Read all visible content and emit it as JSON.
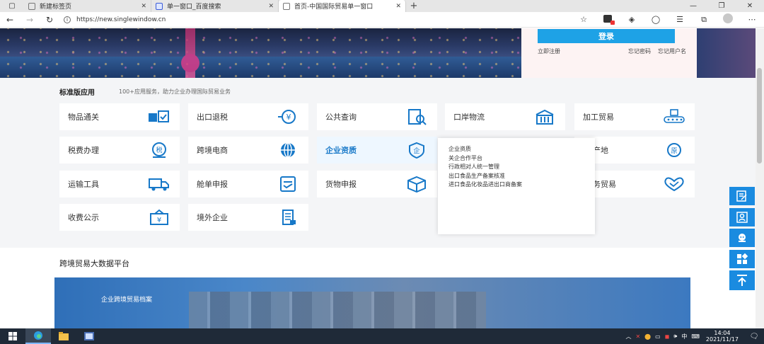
{
  "browser": {
    "tabs": [
      {
        "label": "新建标签页",
        "active": false
      },
      {
        "label": "单一窗口_百度搜索",
        "active": false
      },
      {
        "label": "首页-中国国际贸易单一窗口",
        "active": true
      }
    ],
    "url": "https://new.singlewindow.cn"
  },
  "login": {
    "button": "登录",
    "register": "立即注册",
    "forgot_password": "忘记密码",
    "forgot_username": "忘记用户名"
  },
  "standard": {
    "title": "标准版应用",
    "subtitle": "100+应用服务，助力企业办理国际贸易业务",
    "tiles": [
      {
        "label": "物品通关",
        "icon": "goods-clearance-icon"
      },
      {
        "label": "出口退税",
        "icon": "export-tax-refund-icon"
      },
      {
        "label": "公共查询",
        "icon": "public-query-icon"
      },
      {
        "label": "口岸物流",
        "icon": "port-logistics-icon"
      },
      {
        "label": "加工贸易",
        "icon": "processing-trade-icon"
      },
      {
        "label": "税费办理",
        "icon": "tax-icon"
      },
      {
        "label": "跨境电商",
        "icon": "cross-border-ecommerce-icon"
      },
      {
        "label": "企业资质",
        "icon": "enterprise-qualification-icon"
      },
      {
        "label": "产地",
        "icon": "origin-icon"
      },
      {
        "label": "运输工具",
        "icon": "transport-truck-icon"
      },
      {
        "label": "舱单申报",
        "icon": "manifest-icon"
      },
      {
        "label": "货物申报",
        "icon": "cargo-box-icon"
      },
      {
        "label": "务贸易",
        "icon": "handshake-icon"
      },
      {
        "label": "收费公示",
        "icon": "fee-notice-icon"
      },
      {
        "label": "境外企业",
        "icon": "overseas-enterprise-icon"
      }
    ],
    "dropdown": [
      "企业资质",
      "关企合作平台",
      "行政相对人统一管理",
      "出口食品生产备案核准",
      "进口食品化妆品进出口商备案"
    ]
  },
  "bigdata": {
    "title": "跨境贸易大数据平台",
    "banner_label": "企业跨境贸易档案"
  },
  "taskbar": {
    "time": "14:04",
    "date": "2021/11/17",
    "ime": "中"
  },
  "colors": {
    "accent": "#1ea2e6",
    "icon_blue": "#1778c8",
    "side_blue": "#1a8be0"
  }
}
